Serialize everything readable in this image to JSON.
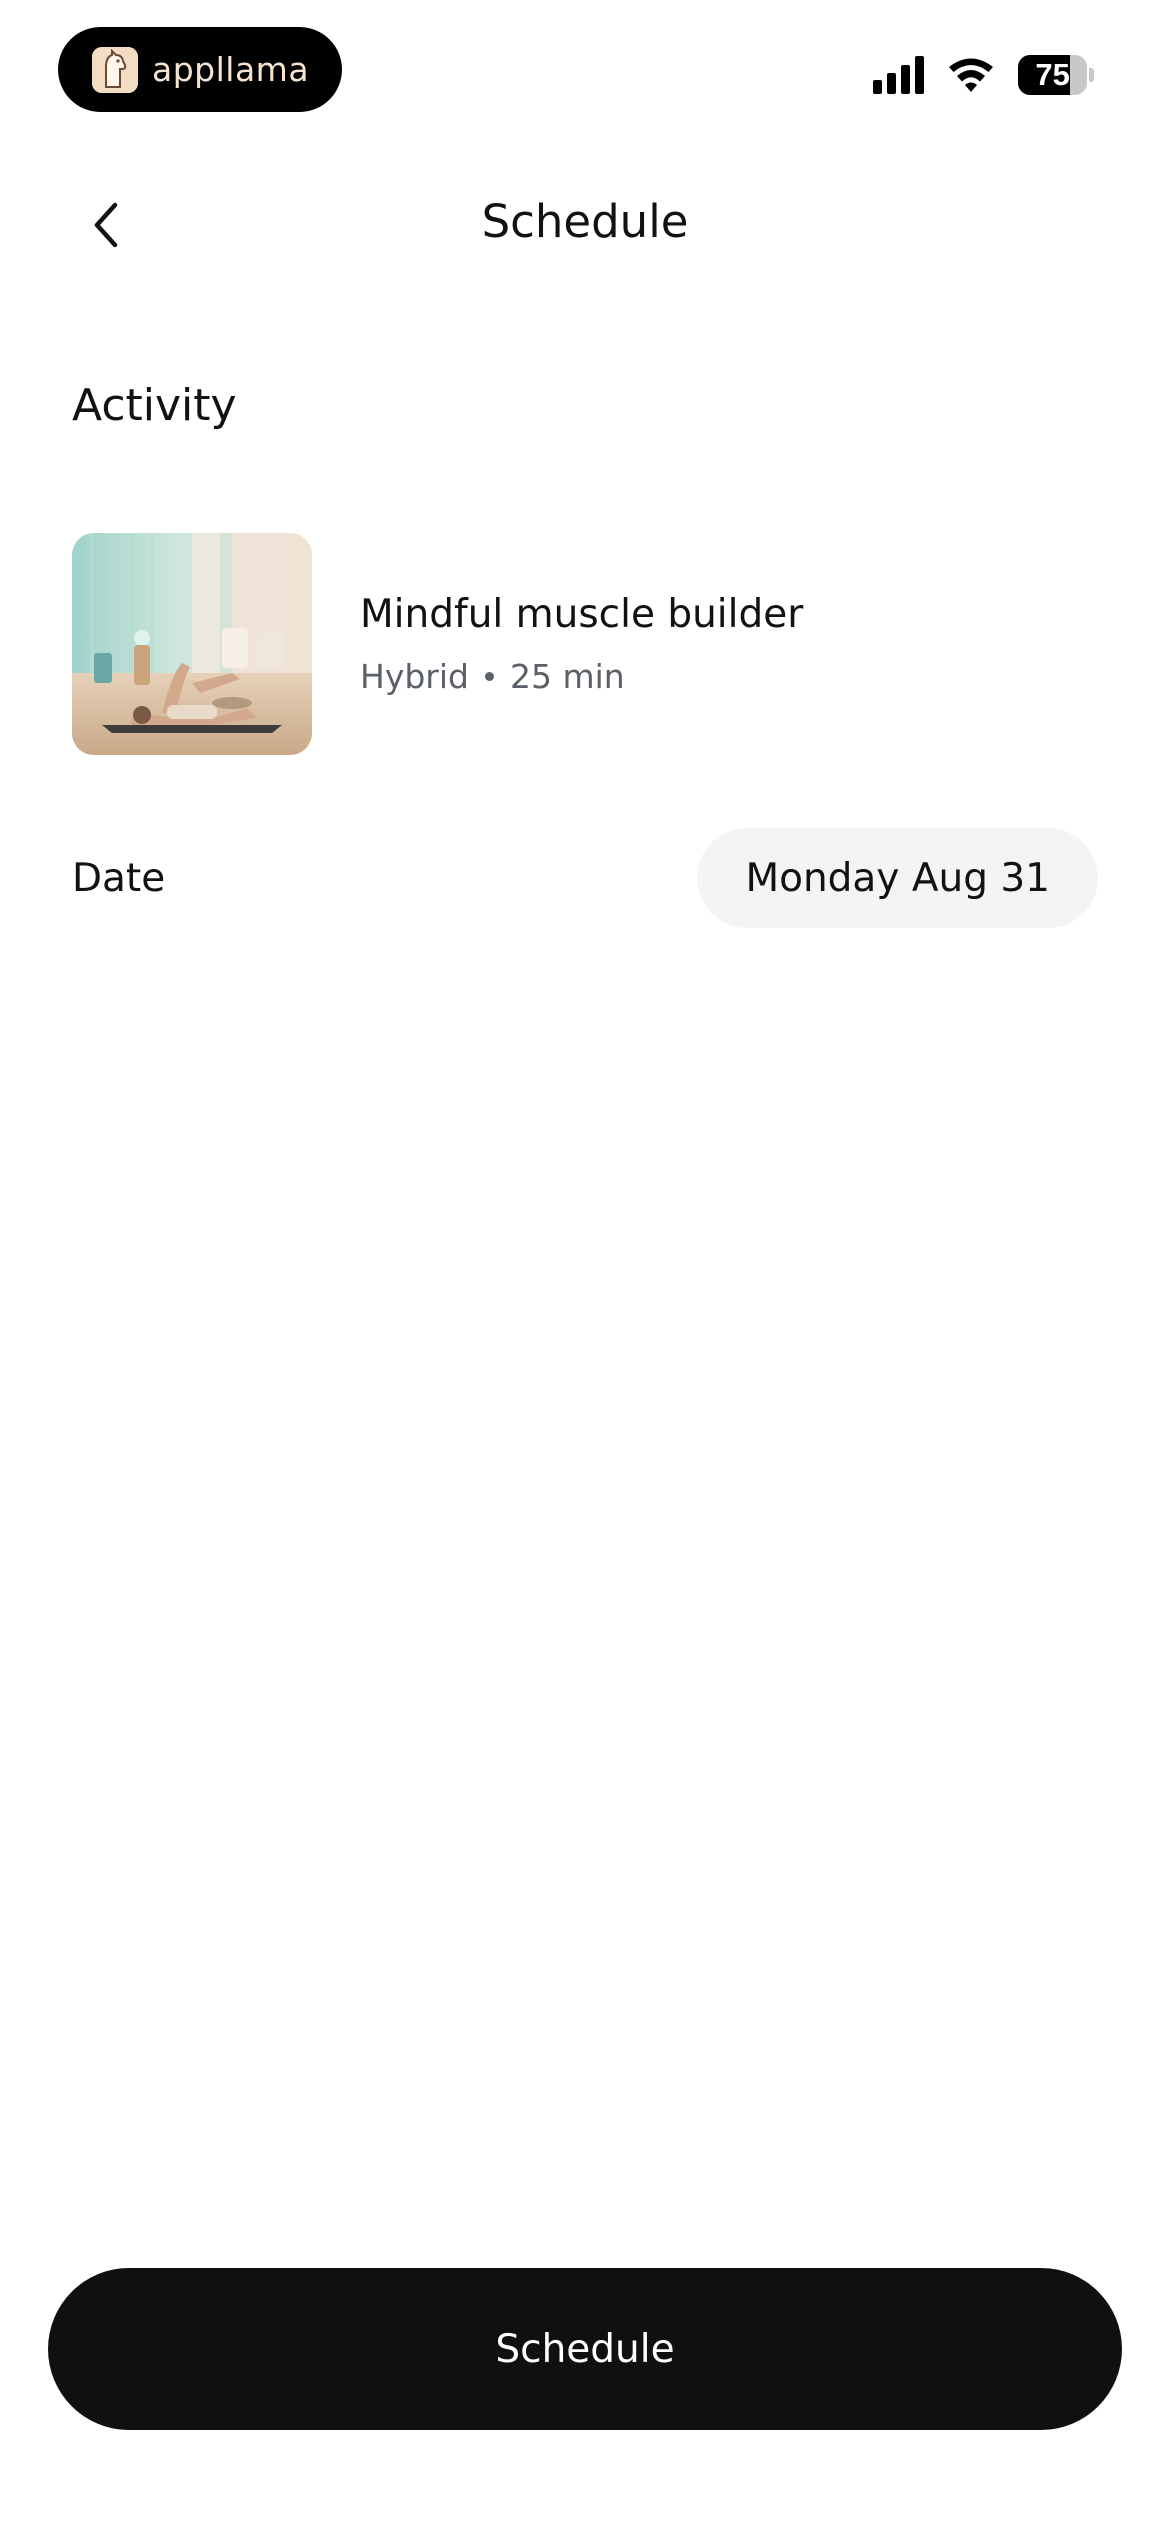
{
  "status_bar": {
    "brand_text": "appllama",
    "battery_level": "75",
    "battery_fraction": 0.75,
    "icons": [
      "llama-logo-icon",
      "cellular-signal-icon",
      "wifi-icon",
      "battery-icon"
    ]
  },
  "header": {
    "title": "Schedule",
    "back_icon": "chevron-left-icon"
  },
  "activity_section": {
    "title": "Activity",
    "item": {
      "name": "Mindful muscle builder",
      "type": "Hybrid",
      "duration": "25 min",
      "thumbnail": "workout-thumbnail"
    }
  },
  "date_section": {
    "label": "Date",
    "value": "Monday Aug 31"
  },
  "cta": {
    "label": "Schedule"
  },
  "colors": {
    "background": "#ffffff",
    "primary_text": "#111214",
    "secondary_text": "#5c6068",
    "chip_bg": "#f3f4f6",
    "button_bg": "#0f1012",
    "button_text": "#ffffff"
  }
}
